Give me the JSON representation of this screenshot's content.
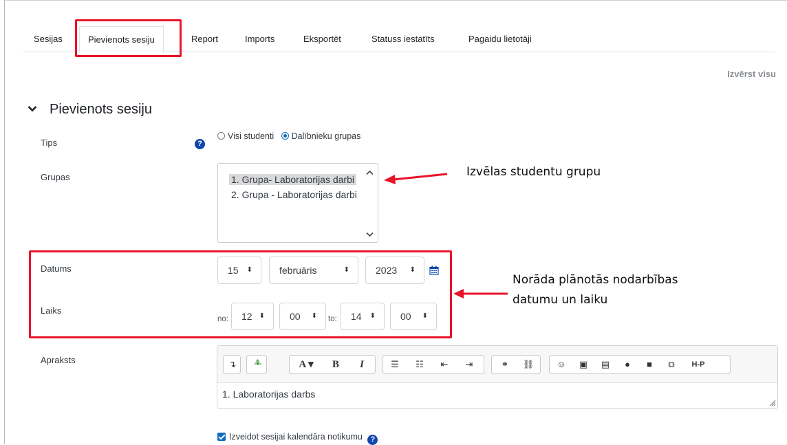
{
  "tabs": [
    {
      "label": "Sesijas"
    },
    {
      "label": "Pievienots sesiju",
      "active": true
    },
    {
      "label": "Report"
    },
    {
      "label": "Imports"
    },
    {
      "label": "Eksportēt"
    },
    {
      "label": "Statuss iestatīts"
    },
    {
      "label": "Pagaidu lietotāji"
    }
  ],
  "expand_all": "Izvērst visu",
  "section": {
    "title": "Pievienots sesiju"
  },
  "form": {
    "tips": {
      "label": "Tips",
      "options": [
        {
          "label": "Visi studenti",
          "checked": false
        },
        {
          "label": "Dalībnieku grupas",
          "checked": true
        }
      ]
    },
    "grupas": {
      "label": "Grupas",
      "options": [
        {
          "label": "1. Grupa- Laboratorijas darbi",
          "selected": true
        },
        {
          "label": "2. Grupa - Laboratorijas darbi",
          "selected": false
        }
      ]
    },
    "datums": {
      "label": "Datums",
      "day": "15",
      "month": "februāris",
      "year": "2023"
    },
    "laiks": {
      "label": "Laiks",
      "from_label": "no:",
      "from_hour": "12",
      "from_min": "00",
      "to_label": "to:",
      "to_hour": "14",
      "to_min": "00"
    },
    "apraksts": {
      "label": "Apraksts",
      "text": "1. Laboratorijas darbs"
    },
    "calendar_event": {
      "label": "Izveidot sesijai kalendāra notikumu",
      "checked": true
    }
  },
  "toolbar_icons": [
    "collapse-icon",
    "accessibility-checker-icon",
    "font-color-icon",
    "bold-icon",
    "italic-icon",
    "unordered-list-icon",
    "ordered-list-icon",
    "outdent-icon",
    "indent-icon",
    "link-icon",
    "unlink-icon",
    "emoji-icon",
    "image-icon",
    "media-icon",
    "record-audio-icon",
    "record-video-icon",
    "manage-files-icon",
    "h5p-icon"
  ],
  "toolbar_text": {
    "font": "A",
    "bold": "B",
    "italic": "I",
    "h5p": "H-P"
  },
  "annotations": {
    "group": "Izvēlas studentu grupu",
    "date_line1": "Norāda plānotās nodarbības",
    "date_line2": "datumu un laiku"
  },
  "colors": {
    "highlight": "#e8142a",
    "accent": "#0f6cbf",
    "help": "#0f47ad"
  }
}
